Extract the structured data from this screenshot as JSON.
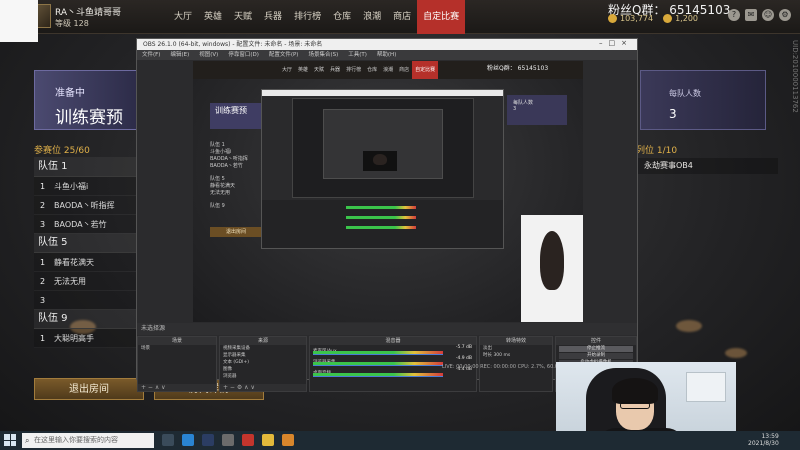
{
  "game": {
    "player": {
      "name": "RA丶斗鱼靖哥哥",
      "level": "等级 128"
    },
    "nav": [
      "大厅",
      "英雄",
      "天赋",
      "兵器",
      "排行榜",
      "仓库",
      "浪潮",
      "商店",
      "自定比赛"
    ],
    "active_nav": "自定比赛",
    "fans_group": "粉丝Q群： 65145103",
    "currency": {
      "gold": "103,774",
      "coupons": "1,200"
    },
    "status": {
      "small": "准备中",
      "big": "训练赛预"
    },
    "team_size": {
      "label": "每队人数",
      "value": "3"
    },
    "queue_left": "参赛位 25/60",
    "queue_right": "列位 1/10",
    "right_list": [
      "永劫赛事OB4"
    ],
    "teams": [
      {
        "name": "队伍 1",
        "members": [
          {
            "i": "1",
            "n": "斗鱼小福i"
          },
          {
            "i": "2",
            "n": "BAODA丶听指挥"
          },
          {
            "i": "3",
            "n": "BAODA丶若竹"
          }
        ]
      },
      {
        "name": "队伍 5",
        "members": [
          {
            "i": "1",
            "n": "静看花满天"
          },
          {
            "i": "2",
            "n": "无法无用"
          },
          {
            "i": "3",
            "n": ""
          }
        ]
      },
      {
        "name": "队伍 9",
        "members": [
          {
            "i": "1",
            "n": "大聪明高手"
          }
        ]
      }
    ],
    "buttons": {
      "exit": "退出房间",
      "details": "房间详情"
    }
  },
  "obs": {
    "title": "OBS 26.1.0 (64-bit, windows) - 配置文件: 未命名 - 场景: 未命名",
    "menu": [
      "文件(F)",
      "编辑(E)",
      "视图(V)",
      "停靠窗口(D)",
      "配置文件(P)",
      "场景集合(S)",
      "工具(T)",
      "帮助(H)"
    ],
    "scene_bar": "未选择源",
    "docks": {
      "scenes": {
        "title": "场景",
        "items": [
          "场景"
        ]
      },
      "sources": {
        "title": "来源",
        "items": [
          "视频采集设备",
          "显示器采集",
          "文本 (GDI+)",
          "图像",
          "浏览器",
          "窗口采集",
          "显示器采集"
        ]
      },
      "mixer": {
        "title": "混音器",
        "tracks": [
          {
            "name": "麦克风/Aux",
            "db": "-5.7 dB"
          },
          {
            "name": "浏览器采集",
            "db": "-4.9 dB"
          },
          {
            "name": "桌面音频",
            "db": "-4.4 dB"
          }
        ]
      },
      "transitions": {
        "title": "转场特效",
        "fade": "淡出",
        "duration_label": "时长",
        "duration": "300 ms"
      },
      "controls": {
        "title": "控件",
        "buttons": [
          "停止推流",
          "开始录制",
          "启动虚拟摄像机",
          "工作室模式",
          "设置",
          "退出"
        ]
      }
    },
    "status": "LIVE: 00:00:00   REC: 00:00:00   CPU: 2.7%, 60.00 fps"
  },
  "taskbar": {
    "search_placeholder": "在这里输入你要搜索的内容",
    "time": "13:59",
    "date": "2021/8/30"
  },
  "side_code": "UID:2010000113762",
  "colors": {
    "accent_red": "#b5302a",
    "gold": "#e2b24a",
    "purple_card": "#4b4a70"
  }
}
